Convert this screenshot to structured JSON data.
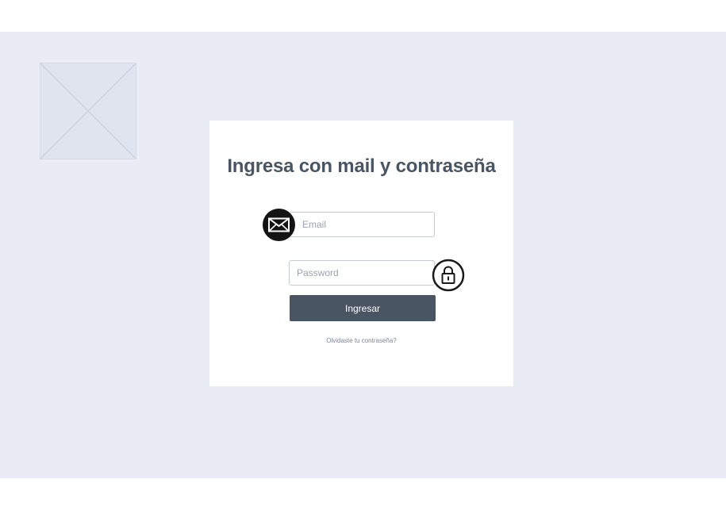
{
  "hero": {
    "image_icon": "image-placeholder-icon"
  },
  "login": {
    "title": "Ingresa con mail y contraseña",
    "email_placeholder": "Email",
    "password_placeholder": "Password",
    "submit_label": "Ingresar",
    "forgot_link": "Olvidaste tu contraseña?",
    "email_icon": "envelope-icon",
    "password_icon": "lock-icon"
  },
  "colors": {
    "background_band": "#e9ecf4",
    "card": "#ffffff",
    "text_primary": "#4a5563",
    "button": "#4a5563",
    "placeholder_text": "#9aa3b2"
  }
}
